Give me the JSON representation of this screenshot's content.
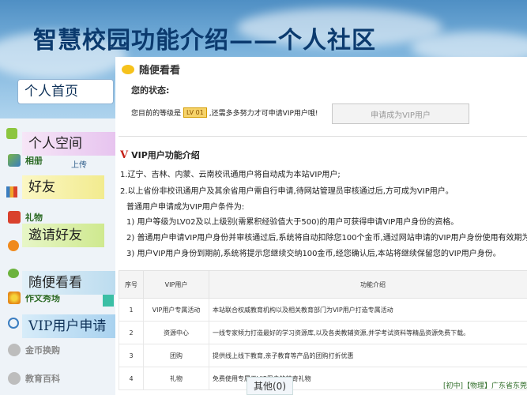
{
  "slide": {
    "title": "智慧校园功能介绍——个人社区"
  },
  "overlay_nav": [
    {
      "label": "个人首页"
    },
    {
      "label": "个人空间"
    },
    {
      "label": "好友"
    },
    {
      "label": "邀请好友"
    },
    {
      "label": "随便看看"
    },
    {
      "label": "VIP用户申请"
    }
  ],
  "sidebar": {
    "items": [
      {
        "label": "相册",
        "icon": "photo-icon"
      },
      {
        "label": "礼物",
        "icon": "gift-icon"
      },
      {
        "label": "作文秀场",
        "icon": "flower-icon"
      },
      {
        "label": "金币换购",
        "icon": "coin-icon"
      },
      {
        "label": "教育百科",
        "icon": "book-icon"
      }
    ],
    "upload_label": "上传"
  },
  "panel": {
    "header": "随便看看",
    "status_label": "您的状态:",
    "level_text_before": "您目前的等级是",
    "level_badge": "LV 01",
    "level_text_after": ",还需多多努力才可申请VIP用户哦!",
    "apply_button": "申请成为VIP用户"
  },
  "vip_intro": {
    "title": "VIP用户功能介绍",
    "rules": [
      "1.辽宁、吉林、内蒙、云南校讯通用户将自动成为本站VIP用户;",
      "2.以上省份非校讯通用户及其余省用户需自行申请,待网站管理员审核通过后,方可成为VIP用户。"
    ],
    "conditions_heading": "普通用户申请成为VIP用户条件为:",
    "conditions": [
      "1) 用户等级为LV02及以上级别(需累积经验值大于500)的用户可获得申请VIP用户身份的资格。",
      "2) 普通用户申请VIP用户身份并审核通过后,系统将自动扣除您100个金币,通过网站申请的VIP用户身份使用有效期为31天。",
      "3) 用户VIP用户身份到期前,系统将提示您继续交纳100金币,经您确认后,本站将继续保留您的VIP用户身份。"
    ]
  },
  "feature_table": {
    "headers": [
      "序号",
      "VIP用户",
      "功能介绍"
    ],
    "rows": [
      [
        "1",
        "VIP用户专属活动",
        "本站联合权威教育机构以及相关教育部门为VIP用户打造专属活动"
      ],
      [
        "2",
        "资源中心",
        "一线专家倾力打造最好的学习资源库,以及各类教辅资源,并学考试资料等精品资源免费下载。"
      ],
      [
        "3",
        "团购",
        "提供线上线下教育,亲子教育等产品的团购打折优惠"
      ],
      [
        "4",
        "礼物",
        "免费使用专属于VIP用户的神奇礼物"
      ]
    ]
  },
  "bottom": {
    "other_tab": "其他(0)",
    "links": "[初中]【物理】广东省东莞"
  },
  "colors": {
    "title": "#0b3a6e",
    "accent_green": "#2d6b26",
    "vip_red": "#c41f16"
  }
}
